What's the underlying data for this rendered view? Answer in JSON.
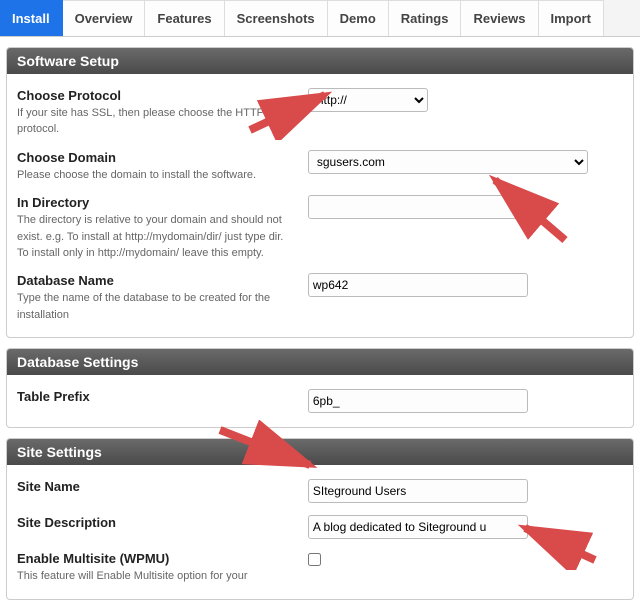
{
  "tabs": [
    {
      "label": "Install",
      "active": true
    },
    {
      "label": "Overview"
    },
    {
      "label": "Features"
    },
    {
      "label": "Screenshots"
    },
    {
      "label": "Demo"
    },
    {
      "label": "Ratings"
    },
    {
      "label": "Reviews"
    },
    {
      "label": "Import"
    }
  ],
  "sections": {
    "software_setup": {
      "title": "Software Setup",
      "protocol": {
        "label": "Choose Protocol",
        "desc": "If your site has SSL, then please choose the HTTPS protocol.",
        "value": "http://"
      },
      "domain": {
        "label": "Choose Domain",
        "desc": "Please choose the domain to install the software.",
        "value": "sgusers.com"
      },
      "directory": {
        "label": "In Directory",
        "desc": "The directory is relative to your domain and should not exist. e.g. To install at http://mydomain/dir/ just type dir. To install only in http://mydomain/ leave this empty.",
        "value": ""
      },
      "database": {
        "label": "Database Name",
        "desc": "Type the name of the database to be created for the installation",
        "value": "wp642"
      }
    },
    "database_settings": {
      "title": "Database Settings",
      "prefix": {
        "label": "Table Prefix",
        "value": "6pb_"
      }
    },
    "site_settings": {
      "title": "Site Settings",
      "site_name": {
        "label": "Site Name",
        "value": "SIteground Users"
      },
      "site_desc": {
        "label": "Site Description",
        "value": "A blog dedicated to Siteground u"
      },
      "multisite": {
        "label": "Enable Multisite (WPMU)",
        "desc": "This feature will Enable Multisite option for your",
        "checked": false
      }
    }
  }
}
